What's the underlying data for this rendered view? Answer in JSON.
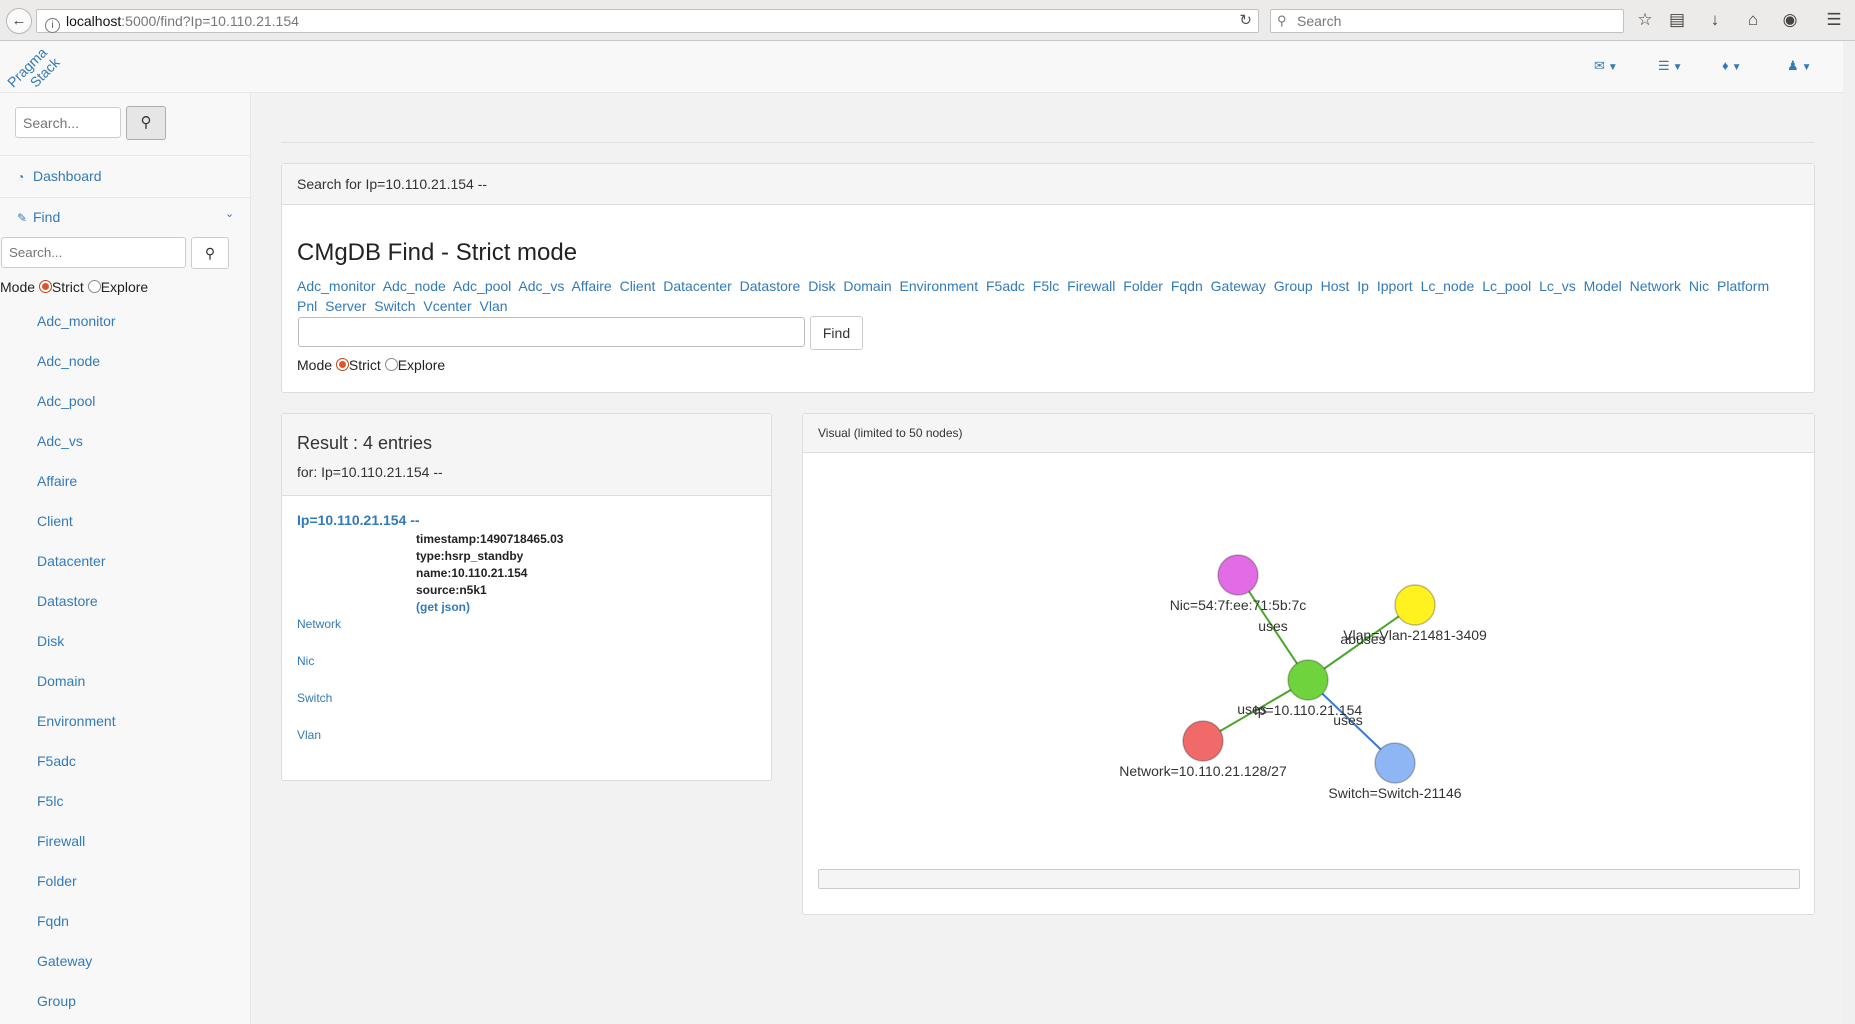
{
  "browser": {
    "url_host": "localhost",
    "url_rest": ":5000/find?Ip=10.110.21.154",
    "search_placeholder": "Search"
  },
  "brand": {
    "line1": "Pragma",
    "line2": "Stack"
  },
  "sidebar": {
    "search_placeholder": "Search...",
    "dashboard": "Dashboard",
    "find": "Find",
    "find_search_placeholder": "Search...",
    "mode_label": "Mode",
    "mode_strict": "Strict",
    "mode_explore": "Explore",
    "items": [
      "Adc_monitor",
      "Adc_node",
      "Adc_pool",
      "Adc_vs",
      "Affaire",
      "Client",
      "Datacenter",
      "Datastore",
      "Disk",
      "Domain",
      "Environment",
      "F5adc",
      "F5lc",
      "Firewall",
      "Folder",
      "Fqdn",
      "Gateway",
      "Group"
    ]
  },
  "search_panel": {
    "header": "Search for Ip=10.110.21.154 --",
    "title": "CMgDB Find - Strict mode",
    "types": [
      "Adc_monitor",
      "Adc_node",
      "Adc_pool",
      "Adc_vs",
      "Affaire",
      "Client",
      "Datacenter",
      "Datastore",
      "Disk",
      "Domain",
      "Environment",
      "F5adc",
      "F5lc",
      "Firewall",
      "Folder",
      "Fqdn",
      "Gateway",
      "Group",
      "Host",
      "Ip",
      "Ipport",
      "Lc_node",
      "Lc_pool",
      "Lc_vs",
      "Model",
      "Network",
      "Nic",
      "Platform",
      "Pnl",
      "Server",
      "Switch",
      "Vcenter",
      "Vlan"
    ],
    "find_button": "Find",
    "mode_label": "Mode",
    "mode_strict": "Strict",
    "mode_explore": "Explore"
  },
  "result": {
    "title": "Result : 4 entries",
    "subtitle": "for: Ip=10.110.21.154 --",
    "entry": "Ip=10.110.21.154 --",
    "timestamp": "timestamp:1490718465.03",
    "type": "type:hsrp_standby",
    "name": "name:10.110.21.154",
    "source": "source:n5k1",
    "get_json": "(get json)",
    "relations": [
      "Network",
      "Nic",
      "Switch",
      "Vlan"
    ]
  },
  "visual": {
    "header": "Visual (limited to 50 nodes)",
    "nodes": [
      {
        "id": "ip",
        "label": "Ip=10.110.21.154",
        "color": "#6ed33c"
      },
      {
        "id": "nic",
        "label": "Nic=54:7f:ee:71:5b:7c",
        "color": "#e26ce6"
      },
      {
        "id": "vlan",
        "label": "Vlan=Vlan-21481-3409",
        "color": "#fff21e"
      },
      {
        "id": "network",
        "label": "Network=10.110.21.128/27",
        "color": "#f06a6a"
      },
      {
        "id": "switch",
        "label": "Switch=Switch-21146",
        "color": "#8eb6f5"
      }
    ],
    "edges": [
      {
        "from": "ip",
        "to": "nic",
        "label": "uses",
        "color": "#4aa52a"
      },
      {
        "from": "ip",
        "to": "vlan",
        "label": "abuses",
        "color": "#4aa52a"
      },
      {
        "from": "ip",
        "to": "network",
        "label": "uses",
        "color": "#4aa52a"
      },
      {
        "from": "ip",
        "to": "switch",
        "label": "uses",
        "color": "#3a78d6"
      }
    ]
  }
}
